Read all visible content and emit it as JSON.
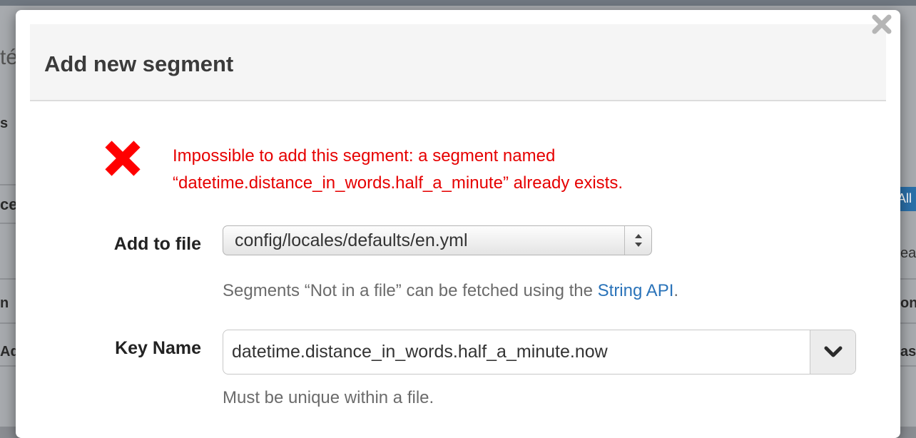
{
  "background": {
    "fragments": [
      "té",
      "s",
      "ce",
      "n",
      "Add",
      "All",
      "ear",
      "on",
      "as"
    ]
  },
  "modal": {
    "title": "Add new segment",
    "close_icon": "close-icon",
    "error": {
      "icon": "error-x-icon",
      "message_line1": "Impossible to add this segment: a segment named",
      "message_line2": "“datetime.distance_in_words.half_a_minute” already exists.",
      "color": "#e60000"
    },
    "file_field": {
      "label": "Add to file",
      "selected": "config/locales/defaults/en.yml",
      "help_prefix": "Segments “Not in a file” can be fetched using the ",
      "help_link": "String API",
      "help_suffix": "."
    },
    "key_field": {
      "label": "Key Name",
      "value": "datetime.distance_in_words.half_a_minute.now",
      "help": "Must be unique within a file."
    }
  },
  "colors": {
    "link": "#2a73b9",
    "error": "#e60000"
  }
}
